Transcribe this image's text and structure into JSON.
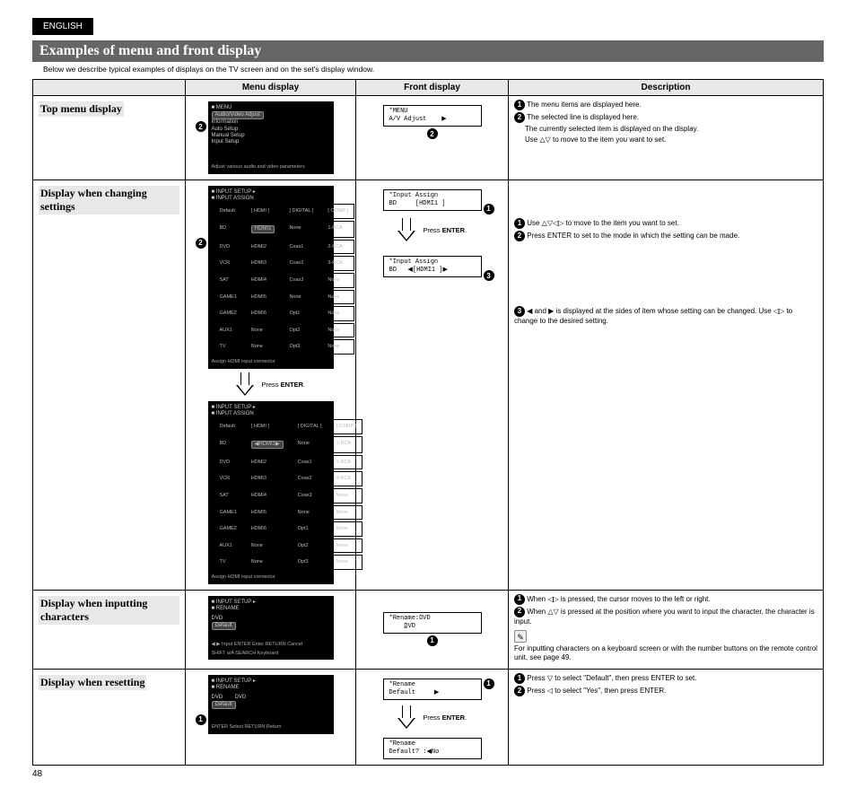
{
  "page": {
    "language": "ENGLISH",
    "number": "48"
  },
  "section": {
    "title": "Examples of menu and front display",
    "intro": "Below we describe typical examples of displays on the TV screen and on the set's display window."
  },
  "columns": {
    "c1": "Menu display",
    "c2": "Front display",
    "c3": "Description"
  },
  "rows": {
    "top": {
      "label": "Top menu display",
      "menu": {
        "header": "MENU",
        "selected": "Audio/Video Adjust",
        "items": [
          "Information",
          "Auto Setup",
          "Manual Setup",
          "Input Setup"
        ],
        "footer": "Adjust various audio and video parameters"
      },
      "front": {
        "line1": "*MENU",
        "line2": "A/V Adjust    ▶"
      },
      "desc": {
        "d1": "The menu items are displayed here.",
        "d2": "The selected line is displayed here.",
        "d3": "The currently selected item is displayed on the display.",
        "d4": "Use △▽ to move to the item you want to set."
      }
    },
    "changing": {
      "label": "Display when changing settings",
      "menu1": {
        "header": "INPUT SETUP ▸",
        "sub": "INPUT ASSIGN",
        "cols": [
          "Default",
          "[ HDMI ]",
          "[ DIGITAL ]",
          "[ COMP ]"
        ],
        "rows": [
          [
            "BD",
            "HDMI1",
            "None",
            "1-RCA"
          ],
          [
            "DVD",
            "HDMI2",
            "Coax1",
            "2-RCA"
          ],
          [
            "VCR",
            "HDMI3",
            "Coax2",
            "3-RCA"
          ],
          [
            "SAT",
            "HDMI4",
            "Coax3",
            "None"
          ],
          [
            "GAME1",
            "HDMI5",
            "None",
            "None"
          ],
          [
            "GAME2",
            "HDMI6",
            "Opt1",
            "None"
          ],
          [
            "AUX1",
            "None",
            "Opt2",
            "None"
          ],
          [
            "TV",
            "None",
            "Opt3",
            "None"
          ]
        ],
        "footer": "Assign HDMI input connector"
      },
      "front1": {
        "line1": "*Input Assign",
        "line2": "BD     [HDMI1 ]"
      },
      "front2": {
        "line1": "*Input Assign",
        "line2": "BD   ◀[HDMI1 ]▶"
      },
      "instr": {
        "enter": "Press ENTER."
      },
      "desc": {
        "d1": "Use △▽◁▷ to move to the item you want to set.",
        "d2": "Press ENTER to set to the mode in which the setting can be made.",
        "d3": "◀ and ▶ is displayed at the sides of item whose setting can be changed. Use ◁▷ to change to the desired setting."
      }
    },
    "input": {
      "label": "Display when inputting characters",
      "menu": {
        "header": "INPUT SETUP ▸",
        "sub": "RENAME",
        "field_label": "DVD",
        "value": "Default",
        "footer": "◀ ▶ Input    ENTER Enter    RETURN Cancel",
        "footer2": "SHIFT a/A    SEARCH Keyboard"
      },
      "front": {
        "line1": "*Rename:DVD",
        "line2": "    D̲VD"
      },
      "desc": {
        "d1": "When ◁▷ is pressed, the cursor moves to the left or right.",
        "d2": "When △▽ is pressed at the position where you want to input the character, the character is input.",
        "d3": "For inputting characters on a keyboard screen or with the number buttons on the remote control unit, see page 49."
      }
    },
    "reset": {
      "label": "Display when resetting",
      "menu": {
        "header": "INPUT SETUP ▸",
        "sub": "RENAME",
        "field_label": "DVD",
        "value": "DVD",
        "default": "Default",
        "footer": "ENTER Select    RETURN Return"
      },
      "front1": {
        "line1": "*Rename",
        "line2": "Default     ▶"
      },
      "front2": {
        "line1": "*Rename",
        "line2": "Default? :◀No"
      },
      "instr": {
        "enter": "Press ENTER."
      },
      "desc": {
        "d1": "Press ▽ to select \"Default\", then press ENTER to set.",
        "d2": "Press ◁ to select \"Yes\", then press ENTER."
      }
    }
  }
}
